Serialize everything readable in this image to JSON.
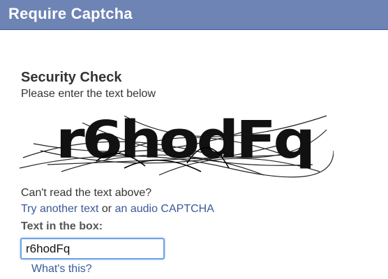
{
  "dialog": {
    "title": "Require Captcha"
  },
  "security": {
    "heading": "Security Check",
    "instruction": "Please enter the text below"
  },
  "captcha": {
    "image_text": "r6hodFq"
  },
  "alternatives": {
    "prompt": "Can't read the text above?",
    "try_another": "Try another text",
    "or_text": "or",
    "audio": "an audio CAPTCHA"
  },
  "input": {
    "label": "Text in the box:",
    "value": "r6hodFq"
  },
  "help": {
    "whats_this": "What's this?"
  },
  "colors": {
    "titlebar": "#6d84b4",
    "link": "#3b5998",
    "input_focus_border": "#6fa0e4"
  }
}
